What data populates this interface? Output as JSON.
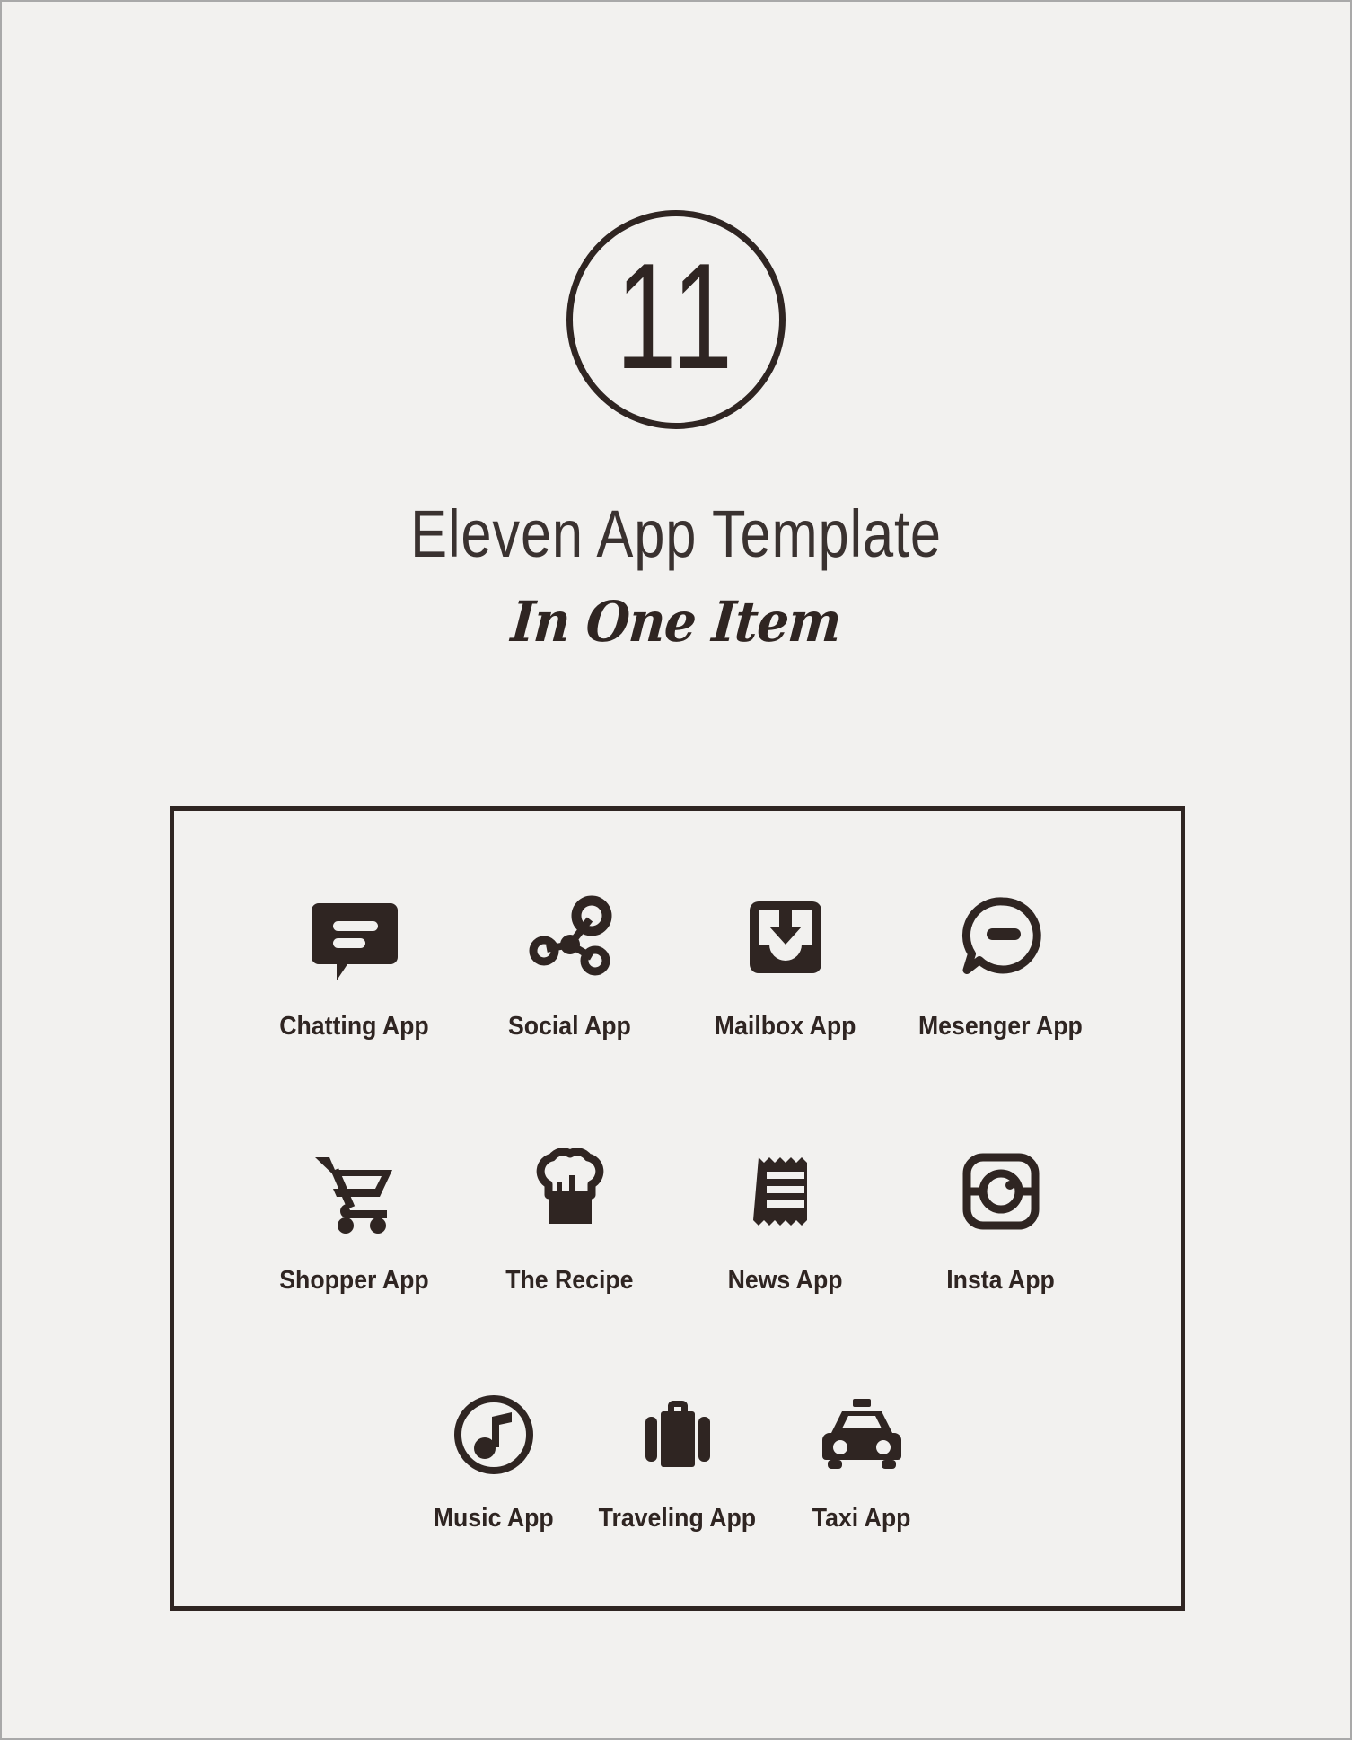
{
  "colors": {
    "background": "#f2f1ef",
    "ink": "#2f2522",
    "title_ink": "#3a3230",
    "page_border": "#a9a9a9"
  },
  "header": {
    "badge_number": "11",
    "title": "Eleven App Template",
    "subtitle": "In One Item"
  },
  "icon_grid": {
    "rows": [
      [
        {
          "label": "Chatting App",
          "icon": "chat-bubble-icon"
        },
        {
          "label": "Social App",
          "icon": "share-network-icon"
        },
        {
          "label": "Mailbox App",
          "icon": "inbox-download-icon"
        },
        {
          "label": "Mesenger App",
          "icon": "messenger-minus-icon"
        }
      ],
      [
        {
          "label": "Shopper App",
          "icon": "shopping-cart-icon"
        },
        {
          "label": "The Recipe",
          "icon": "chef-hat-icon"
        },
        {
          "label": "News App",
          "icon": "newspaper-receipt-icon"
        },
        {
          "label": "Insta App",
          "icon": "camera-square-icon"
        }
      ],
      [
        {
          "label": "Music App",
          "icon": "music-note-circle-icon"
        },
        {
          "label": "Traveling App",
          "icon": "suitcase-icon"
        },
        {
          "label": "Taxi App",
          "icon": "taxi-car-icon"
        }
      ]
    ]
  }
}
